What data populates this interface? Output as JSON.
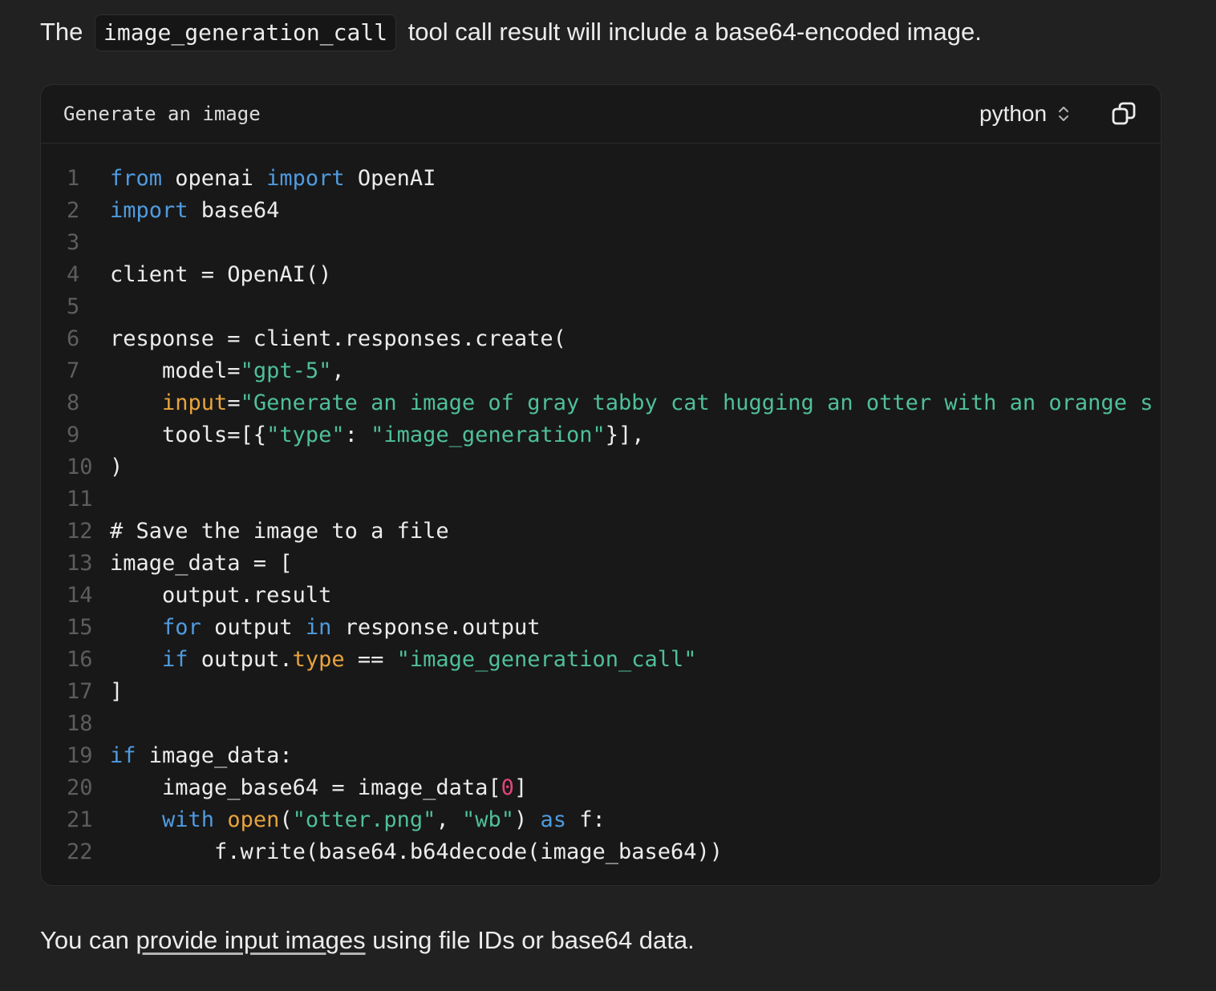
{
  "intro": {
    "before": "The",
    "inline_code": "image_generation_call",
    "after": "tool call result will include a base64-encoded image."
  },
  "code_block": {
    "title": "Generate an image",
    "language": "python",
    "copy_icon": "copy-icon",
    "lines": [
      {
        "n": "1",
        "tokens": [
          [
            "kw",
            "from"
          ],
          [
            "p",
            " openai "
          ],
          [
            "kw",
            "import"
          ],
          [
            "p",
            " OpenAI"
          ]
        ]
      },
      {
        "n": "2",
        "tokens": [
          [
            "kw",
            "import"
          ],
          [
            "p",
            " base64"
          ]
        ]
      },
      {
        "n": "3",
        "tokens": []
      },
      {
        "n": "4",
        "tokens": [
          [
            "p",
            "client = OpenAI()"
          ]
        ]
      },
      {
        "n": "5",
        "tokens": []
      },
      {
        "n": "6",
        "tokens": [
          [
            "p",
            "response = client.responses.create("
          ]
        ]
      },
      {
        "n": "7",
        "tokens": [
          [
            "p",
            "    model="
          ],
          [
            "str",
            "\"gpt-5\""
          ],
          [
            "p",
            ","
          ]
        ]
      },
      {
        "n": "8",
        "tokens": [
          [
            "p",
            "    "
          ],
          [
            "attr",
            "input"
          ],
          [
            "p",
            "="
          ],
          [
            "str",
            "\"Generate an image of gray tabby cat hugging an otter with an orange s"
          ]
        ]
      },
      {
        "n": "9",
        "tokens": [
          [
            "p",
            "    tools=[{"
          ],
          [
            "str",
            "\"type\""
          ],
          [
            "p",
            ": "
          ],
          [
            "str",
            "\"image_generation\""
          ],
          [
            "p",
            "}],"
          ]
        ]
      },
      {
        "n": "10",
        "tokens": [
          [
            "p",
            ")"
          ]
        ]
      },
      {
        "n": "11",
        "tokens": []
      },
      {
        "n": "12",
        "tokens": [
          [
            "p",
            "# Save the image to a file"
          ]
        ]
      },
      {
        "n": "13",
        "tokens": [
          [
            "p",
            "image_data = ["
          ]
        ]
      },
      {
        "n": "14",
        "tokens": [
          [
            "p",
            "    output.result"
          ]
        ]
      },
      {
        "n": "15",
        "tokens": [
          [
            "p",
            "    "
          ],
          [
            "kw",
            "for"
          ],
          [
            "p",
            " output "
          ],
          [
            "kw",
            "in"
          ],
          [
            "p",
            " response.output"
          ]
        ]
      },
      {
        "n": "16",
        "tokens": [
          [
            "p",
            "    "
          ],
          [
            "kw",
            "if"
          ],
          [
            "p",
            " output."
          ],
          [
            "attr",
            "type"
          ],
          [
            "p",
            " == "
          ],
          [
            "str",
            "\"image_generation_call\""
          ]
        ]
      },
      {
        "n": "17",
        "tokens": [
          [
            "p",
            "]"
          ]
        ]
      },
      {
        "n": "18",
        "tokens": []
      },
      {
        "n": "19",
        "tokens": [
          [
            "kw",
            "if"
          ],
          [
            "p",
            " image_data:"
          ]
        ]
      },
      {
        "n": "20",
        "tokens": [
          [
            "p",
            "    image_base64 = image_data["
          ],
          [
            "num",
            "0"
          ],
          [
            "p",
            "]"
          ]
        ]
      },
      {
        "n": "21",
        "tokens": [
          [
            "p",
            "    "
          ],
          [
            "kw",
            "with"
          ],
          [
            "p",
            " "
          ],
          [
            "attr",
            "open"
          ],
          [
            "p",
            "("
          ],
          [
            "str",
            "\"otter.png\""
          ],
          [
            "p",
            ", "
          ],
          [
            "str",
            "\"wb\""
          ],
          [
            "p",
            ") "
          ],
          [
            "kw",
            "as"
          ],
          [
            "p",
            " f:"
          ]
        ]
      },
      {
        "n": "22",
        "tokens": [
          [
            "p",
            "        f.write(base64.b64decode(image_base64))"
          ]
        ]
      }
    ]
  },
  "outro": {
    "before": "You can",
    "link": "provide input images",
    "after": "using file IDs or base64 data."
  },
  "colors": {
    "background": "#212121",
    "code_background": "#181818",
    "keyword": "#4f9be0",
    "string": "#4fbf9b",
    "attribute": "#e8a33d",
    "number": "#e0457b",
    "line_number": "#5d5d5d"
  }
}
